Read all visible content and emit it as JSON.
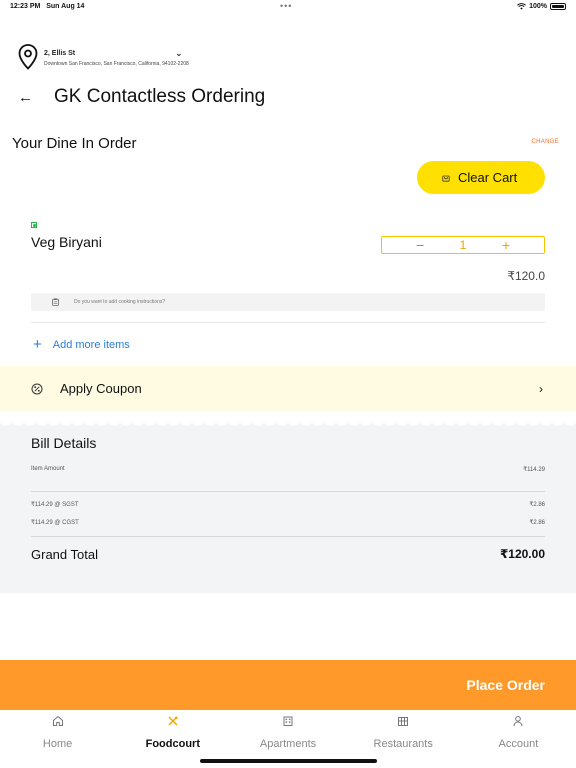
{
  "status_bar": {
    "time": "12:23 PM",
    "date": "Sun Aug 14",
    "dots": "•••",
    "battery": "100%"
  },
  "location": {
    "line1": "2, Ellis St",
    "line2": "Downtown San Francisco, San Francisco, California, 94102-2208",
    "chevron": "⌄"
  },
  "header": {
    "title": "GK Contactless Ordering",
    "back_icon": "←"
  },
  "order": {
    "title": "Your Dine In Order",
    "change_label": "CHANGE",
    "clear_cart_label": "Clear Cart",
    "items": [
      {
        "name": "Veg Biryani",
        "quantity": "1",
        "price": "₹120.0",
        "minus": "−",
        "plus": "+"
      }
    ],
    "instructions_placeholder": "Do you want to add cooking instructions?",
    "add_more_label": "Add more items",
    "add_more_icon": "+"
  },
  "coupon": {
    "label": "Apply Coupon",
    "chevron": "›"
  },
  "bill": {
    "title": "Bill Details",
    "rows": [
      {
        "label": "Item Amount",
        "value": "₹114.29"
      },
      {
        "label": "₹114.29 @ SGST",
        "value": "₹2.86"
      },
      {
        "label": "₹114.29 @ CGST",
        "value": "₹2.86"
      }
    ],
    "grand_total_label": "Grand Total",
    "grand_total_value": "₹120.00"
  },
  "place_order_label": "Place Order",
  "tabs": [
    {
      "label": "Home",
      "icon": "home-icon",
      "active": false
    },
    {
      "label": "Foodcourt",
      "icon": "foodcourt-icon",
      "active": true
    },
    {
      "label": "Apartments",
      "icon": "apartments-icon",
      "active": false
    },
    {
      "label": "Restaurants",
      "icon": "restaurants-icon",
      "active": false
    },
    {
      "label": "Account",
      "icon": "account-icon",
      "active": false
    }
  ],
  "colors": {
    "accent_yellow": "#ffe000",
    "accent_orange": "#ff9a2a",
    "link_blue": "#2a7fd8",
    "veg_green": "#2bb34a",
    "change_orange": "#ff6b2c"
  }
}
